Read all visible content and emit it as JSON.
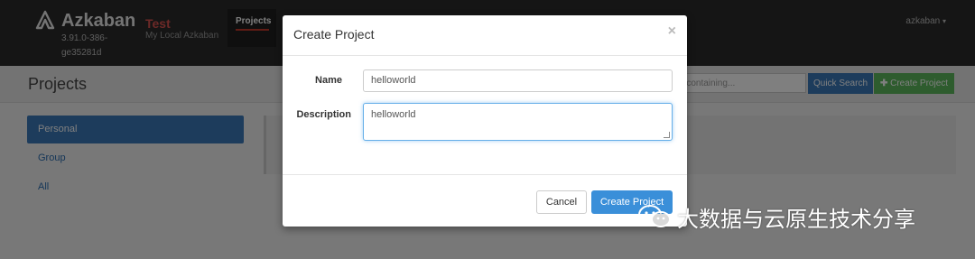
{
  "navbar": {
    "brand": "Azkaban",
    "version": "3.91.0-386-ge35281d",
    "env_name": "Test",
    "env_desc": "My Local Azkaban",
    "nav_projects": "Projects",
    "user": "azkaban",
    "user_caret": "▾",
    "logo_icon": "azkaban-logo-icon"
  },
  "subheader": {
    "title": "Projects",
    "search_placeholder": "e containing...",
    "quick_search": "Quick Search",
    "create_project": "Create Project",
    "create_icon": "plus-icon"
  },
  "sidebar": {
    "items": [
      {
        "label": "Personal",
        "active": true
      },
      {
        "label": "Group",
        "active": false
      },
      {
        "label": "All",
        "active": false
      }
    ]
  },
  "modal": {
    "title": "Create Project",
    "close": "×",
    "name_label": "Name",
    "name_value": "helloworld",
    "desc_label": "Description",
    "desc_value": "helloworld",
    "cancel": "Cancel",
    "submit": "Create Project"
  },
  "watermark": {
    "text": "大数据与云原生技术分享",
    "icon": "wechat-icon"
  },
  "colors": {
    "navbar_bg": "#2b2b2b",
    "primary": "#3a79b8",
    "success": "#5cb85c",
    "env_red": "#d9534f"
  }
}
